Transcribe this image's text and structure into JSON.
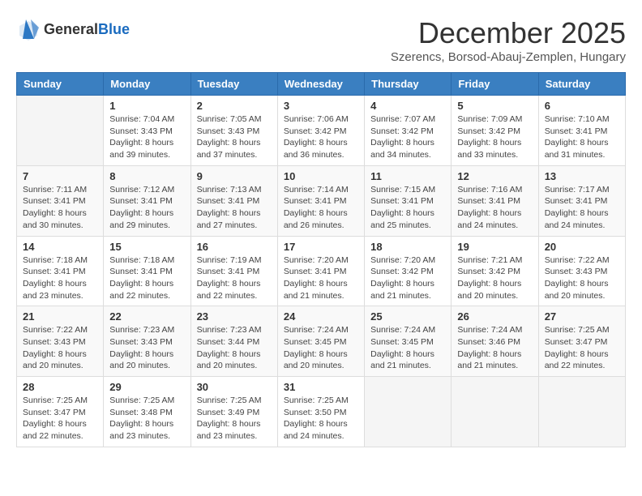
{
  "header": {
    "logo_general": "General",
    "logo_blue": "Blue",
    "title": "December 2025",
    "location": "Szerencs, Borsod-Abauj-Zemplen, Hungary"
  },
  "days_of_week": [
    "Sunday",
    "Monday",
    "Tuesday",
    "Wednesday",
    "Thursday",
    "Friday",
    "Saturday"
  ],
  "weeks": [
    {
      "days": [
        {
          "num": "",
          "sunrise": "",
          "sunset": "",
          "daylight": ""
        },
        {
          "num": "1",
          "sunrise": "Sunrise: 7:04 AM",
          "sunset": "Sunset: 3:43 PM",
          "daylight": "Daylight: 8 hours and 39 minutes."
        },
        {
          "num": "2",
          "sunrise": "Sunrise: 7:05 AM",
          "sunset": "Sunset: 3:43 PM",
          "daylight": "Daylight: 8 hours and 37 minutes."
        },
        {
          "num": "3",
          "sunrise": "Sunrise: 7:06 AM",
          "sunset": "Sunset: 3:42 PM",
          "daylight": "Daylight: 8 hours and 36 minutes."
        },
        {
          "num": "4",
          "sunrise": "Sunrise: 7:07 AM",
          "sunset": "Sunset: 3:42 PM",
          "daylight": "Daylight: 8 hours and 34 minutes."
        },
        {
          "num": "5",
          "sunrise": "Sunrise: 7:09 AM",
          "sunset": "Sunset: 3:42 PM",
          "daylight": "Daylight: 8 hours and 33 minutes."
        },
        {
          "num": "6",
          "sunrise": "Sunrise: 7:10 AM",
          "sunset": "Sunset: 3:41 PM",
          "daylight": "Daylight: 8 hours and 31 minutes."
        }
      ]
    },
    {
      "days": [
        {
          "num": "7",
          "sunrise": "Sunrise: 7:11 AM",
          "sunset": "Sunset: 3:41 PM",
          "daylight": "Daylight: 8 hours and 30 minutes."
        },
        {
          "num": "8",
          "sunrise": "Sunrise: 7:12 AM",
          "sunset": "Sunset: 3:41 PM",
          "daylight": "Daylight: 8 hours and 29 minutes."
        },
        {
          "num": "9",
          "sunrise": "Sunrise: 7:13 AM",
          "sunset": "Sunset: 3:41 PM",
          "daylight": "Daylight: 8 hours and 27 minutes."
        },
        {
          "num": "10",
          "sunrise": "Sunrise: 7:14 AM",
          "sunset": "Sunset: 3:41 PM",
          "daylight": "Daylight: 8 hours and 26 minutes."
        },
        {
          "num": "11",
          "sunrise": "Sunrise: 7:15 AM",
          "sunset": "Sunset: 3:41 PM",
          "daylight": "Daylight: 8 hours and 25 minutes."
        },
        {
          "num": "12",
          "sunrise": "Sunrise: 7:16 AM",
          "sunset": "Sunset: 3:41 PM",
          "daylight": "Daylight: 8 hours and 24 minutes."
        },
        {
          "num": "13",
          "sunrise": "Sunrise: 7:17 AM",
          "sunset": "Sunset: 3:41 PM",
          "daylight": "Daylight: 8 hours and 24 minutes."
        }
      ]
    },
    {
      "days": [
        {
          "num": "14",
          "sunrise": "Sunrise: 7:18 AM",
          "sunset": "Sunset: 3:41 PM",
          "daylight": "Daylight: 8 hours and 23 minutes."
        },
        {
          "num": "15",
          "sunrise": "Sunrise: 7:18 AM",
          "sunset": "Sunset: 3:41 PM",
          "daylight": "Daylight: 8 hours and 22 minutes."
        },
        {
          "num": "16",
          "sunrise": "Sunrise: 7:19 AM",
          "sunset": "Sunset: 3:41 PM",
          "daylight": "Daylight: 8 hours and 22 minutes."
        },
        {
          "num": "17",
          "sunrise": "Sunrise: 7:20 AM",
          "sunset": "Sunset: 3:41 PM",
          "daylight": "Daylight: 8 hours and 21 minutes."
        },
        {
          "num": "18",
          "sunrise": "Sunrise: 7:20 AM",
          "sunset": "Sunset: 3:42 PM",
          "daylight": "Daylight: 8 hours and 21 minutes."
        },
        {
          "num": "19",
          "sunrise": "Sunrise: 7:21 AM",
          "sunset": "Sunset: 3:42 PM",
          "daylight": "Daylight: 8 hours and 20 minutes."
        },
        {
          "num": "20",
          "sunrise": "Sunrise: 7:22 AM",
          "sunset": "Sunset: 3:43 PM",
          "daylight": "Daylight: 8 hours and 20 minutes."
        }
      ]
    },
    {
      "days": [
        {
          "num": "21",
          "sunrise": "Sunrise: 7:22 AM",
          "sunset": "Sunset: 3:43 PM",
          "daylight": "Daylight: 8 hours and 20 minutes."
        },
        {
          "num": "22",
          "sunrise": "Sunrise: 7:23 AM",
          "sunset": "Sunset: 3:43 PM",
          "daylight": "Daylight: 8 hours and 20 minutes."
        },
        {
          "num": "23",
          "sunrise": "Sunrise: 7:23 AM",
          "sunset": "Sunset: 3:44 PM",
          "daylight": "Daylight: 8 hours and 20 minutes."
        },
        {
          "num": "24",
          "sunrise": "Sunrise: 7:24 AM",
          "sunset": "Sunset: 3:45 PM",
          "daylight": "Daylight: 8 hours and 20 minutes."
        },
        {
          "num": "25",
          "sunrise": "Sunrise: 7:24 AM",
          "sunset": "Sunset: 3:45 PM",
          "daylight": "Daylight: 8 hours and 21 minutes."
        },
        {
          "num": "26",
          "sunrise": "Sunrise: 7:24 AM",
          "sunset": "Sunset: 3:46 PM",
          "daylight": "Daylight: 8 hours and 21 minutes."
        },
        {
          "num": "27",
          "sunrise": "Sunrise: 7:25 AM",
          "sunset": "Sunset: 3:47 PM",
          "daylight": "Daylight: 8 hours and 22 minutes."
        }
      ]
    },
    {
      "days": [
        {
          "num": "28",
          "sunrise": "Sunrise: 7:25 AM",
          "sunset": "Sunset: 3:47 PM",
          "daylight": "Daylight: 8 hours and 22 minutes."
        },
        {
          "num": "29",
          "sunrise": "Sunrise: 7:25 AM",
          "sunset": "Sunset: 3:48 PM",
          "daylight": "Daylight: 8 hours and 23 minutes."
        },
        {
          "num": "30",
          "sunrise": "Sunrise: 7:25 AM",
          "sunset": "Sunset: 3:49 PM",
          "daylight": "Daylight: 8 hours and 23 minutes."
        },
        {
          "num": "31",
          "sunrise": "Sunrise: 7:25 AM",
          "sunset": "Sunset: 3:50 PM",
          "daylight": "Daylight: 8 hours and 24 minutes."
        },
        {
          "num": "",
          "sunrise": "",
          "sunset": "",
          "daylight": ""
        },
        {
          "num": "",
          "sunrise": "",
          "sunset": "",
          "daylight": ""
        },
        {
          "num": "",
          "sunrise": "",
          "sunset": "",
          "daylight": ""
        }
      ]
    }
  ]
}
